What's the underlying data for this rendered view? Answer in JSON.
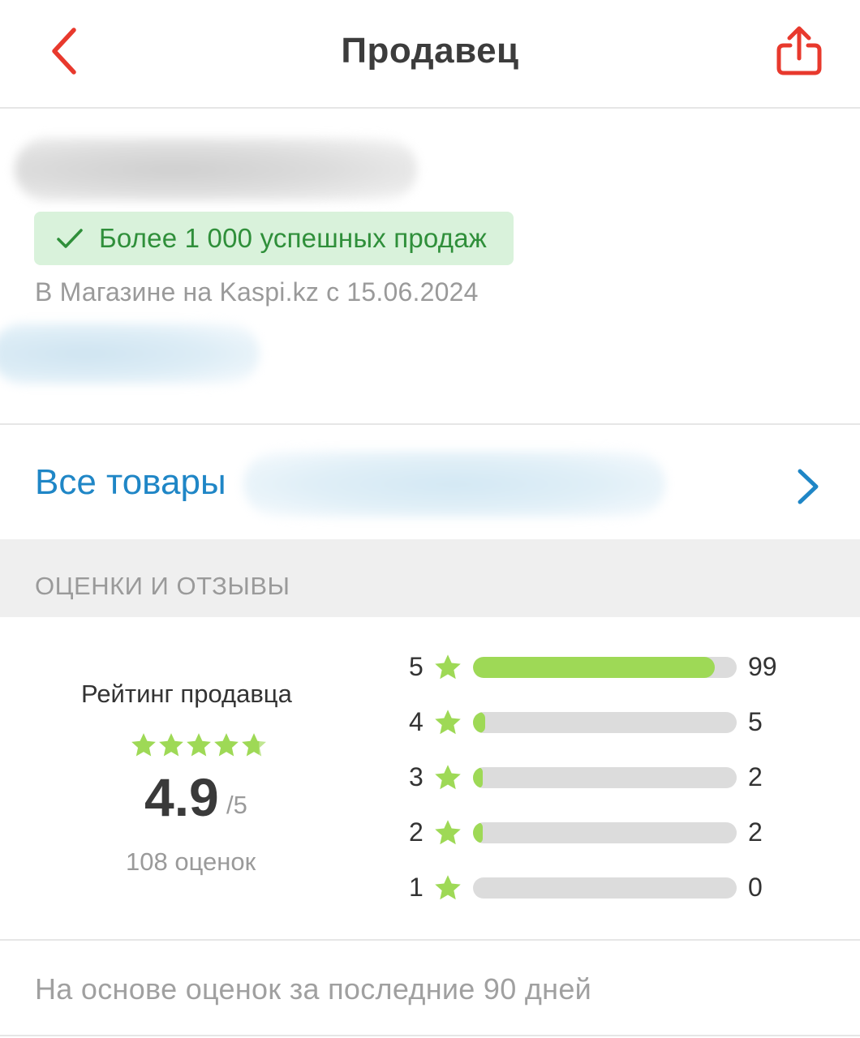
{
  "header": {
    "title": "Продавец",
    "back_icon": "chevron-left-icon",
    "share_icon": "share-icon",
    "accent_color": "#e8392d"
  },
  "seller": {
    "badge_text": "Более 1 000 успешных продаж",
    "badge_icon": "checkmark-icon",
    "since_text": "В Магазине на Kaspi.kz с 15.06.2024"
  },
  "all_products": {
    "label": "Все товары",
    "chevron_icon": "chevron-right-icon",
    "link_color": "#1f86c6"
  },
  "reviews": {
    "section_title": "ОЦЕНКИ И ОТЗЫВЫ",
    "rating_label": "Рейтинг продавца",
    "rating_value": "4.9",
    "rating_max": "/5",
    "rating_count": "108 оценок",
    "star_color": "#9ed956",
    "distribution": [
      {
        "stars": "5",
        "count": "99",
        "fraction": 0.917
      },
      {
        "stars": "4",
        "count": "5",
        "fraction": 0.046
      },
      {
        "stars": "3",
        "count": "2",
        "fraction": 0.019
      },
      {
        "stars": "2",
        "count": "2",
        "fraction": 0.019
      },
      {
        "stars": "1",
        "count": "0",
        "fraction": 0
      }
    ],
    "footer_note": "На основе оценок за последние 90 дней"
  }
}
